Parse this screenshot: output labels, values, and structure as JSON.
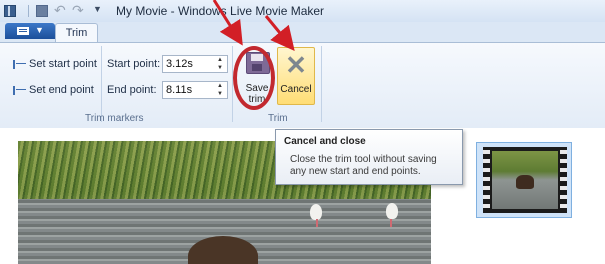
{
  "window": {
    "title": "My Movie - Windows Live Movie Maker"
  },
  "ribbon": {
    "tabs": [
      {
        "label": "Trim"
      }
    ],
    "trim_markers": {
      "set_start_label": "Set start point",
      "set_end_label": "Set end point",
      "start_point_label": "Start point:",
      "start_point_value": "3.12s",
      "end_point_label": "End point:",
      "end_point_value": "8.11s",
      "group_label": "Trim markers"
    },
    "trim": {
      "save_label": "Save trim",
      "cancel_label": "Cancel",
      "group_label": "Trim"
    }
  },
  "tooltip": {
    "title": "Cancel and close",
    "body": "Close the trim tool without saving any new start and end points."
  },
  "annotation": {
    "color": "#c2292f"
  },
  "icons": [
    "app-icon",
    "save-icon",
    "undo-icon",
    "redo-icon",
    "customize-dropdown-icon",
    "set-start-point-icon",
    "set-end-point-icon",
    "save-trim-icon",
    "cancel-icon"
  ]
}
